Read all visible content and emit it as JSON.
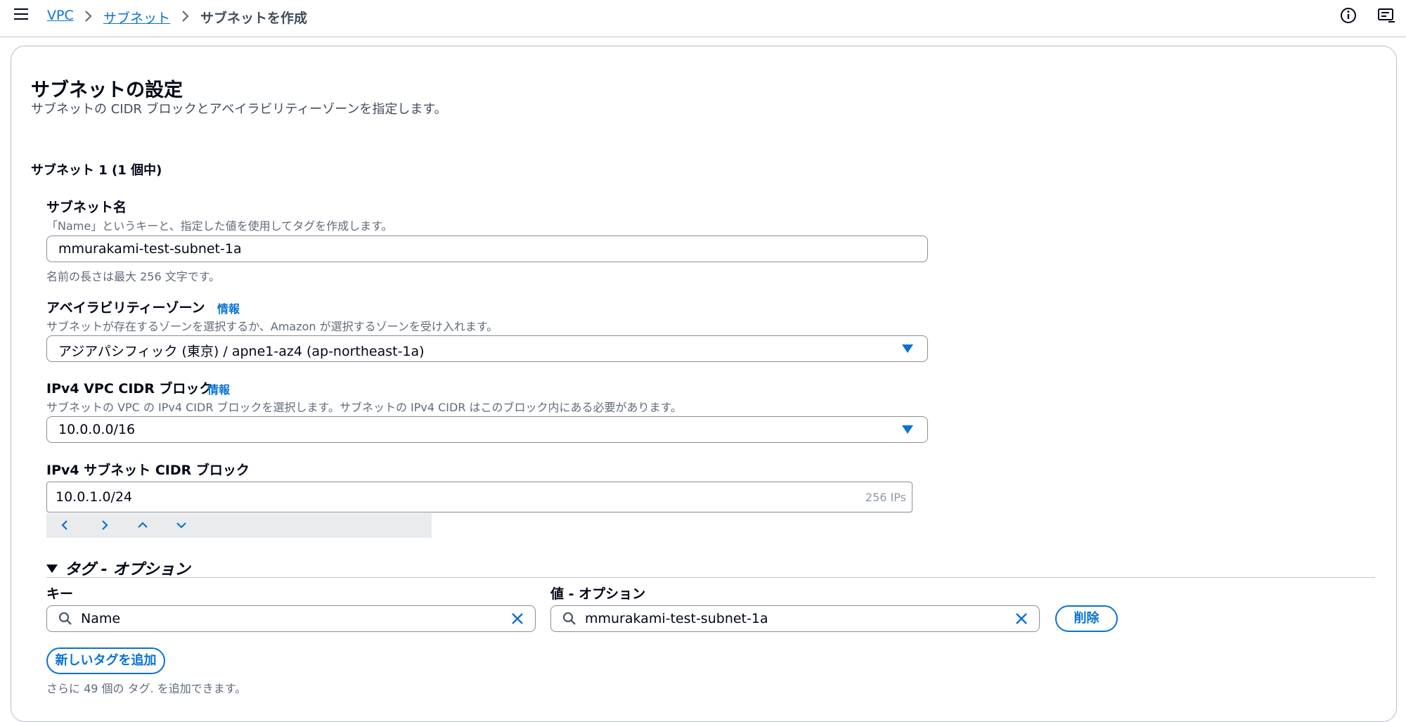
{
  "breadcrumb": {
    "items": [
      "VPC",
      "サブネット"
    ],
    "current": "サブネットを作成"
  },
  "icons": {
    "menu": "menu-icon",
    "info": "info-circle-icon",
    "feedback": "feedback-icon",
    "chevron": "chevron-right-icon",
    "search": "search-icon",
    "clear": "close-icon",
    "dropdown": "caret-down-icon"
  },
  "colors": {
    "link": "#0972d3",
    "text": "#000716",
    "muted": "#5f6b7a"
  },
  "section": {
    "title": "サブネットの設定",
    "description": "サブネットの CIDR ブロックとアベイラビリティーゾーンを指定します。",
    "subnet_heading": "サブネット 1 (1 個中)"
  },
  "subnet_name": {
    "label": "サブネット名",
    "description": "「Name」というキーと、指定した値を使用してタグを作成します。",
    "value": "mmurakami-test-subnet-1a",
    "constraint": "名前の長さは最大 256 文字です。"
  },
  "availability_zone": {
    "label": "アベイラビリティーゾーン",
    "info": "情報",
    "description": "サブネットが存在するゾーンを選択するか、Amazon が選択するゾーンを受け入れます。",
    "value": "アジアパシフィック (東京) / apne1-az4 (ap-northeast-1a)"
  },
  "vpc_cidr": {
    "label": "IPv4 VPC CIDR ブロック",
    "info": "情報",
    "description": "サブネットの VPC の IPv4 CIDR ブロックを選択します。サブネットの IPv4 CIDR はこのブロック内にある必要があります。",
    "value": "10.0.0.0/16"
  },
  "subnet_cidr": {
    "label": "IPv4 サブネット CIDR ブロック",
    "value": "10.0.1.0/24",
    "ips": "256 IPs"
  },
  "tags": {
    "heading": "タグ - オプション",
    "key_label": "キー",
    "value_label": "値 - オプション",
    "key": "Name",
    "value": "mmurakami-test-subnet-1a",
    "remove_label": "削除",
    "add_label": "新しいタグを追加",
    "remaining": "さらに 49 個の タグ. を追加できます。"
  }
}
